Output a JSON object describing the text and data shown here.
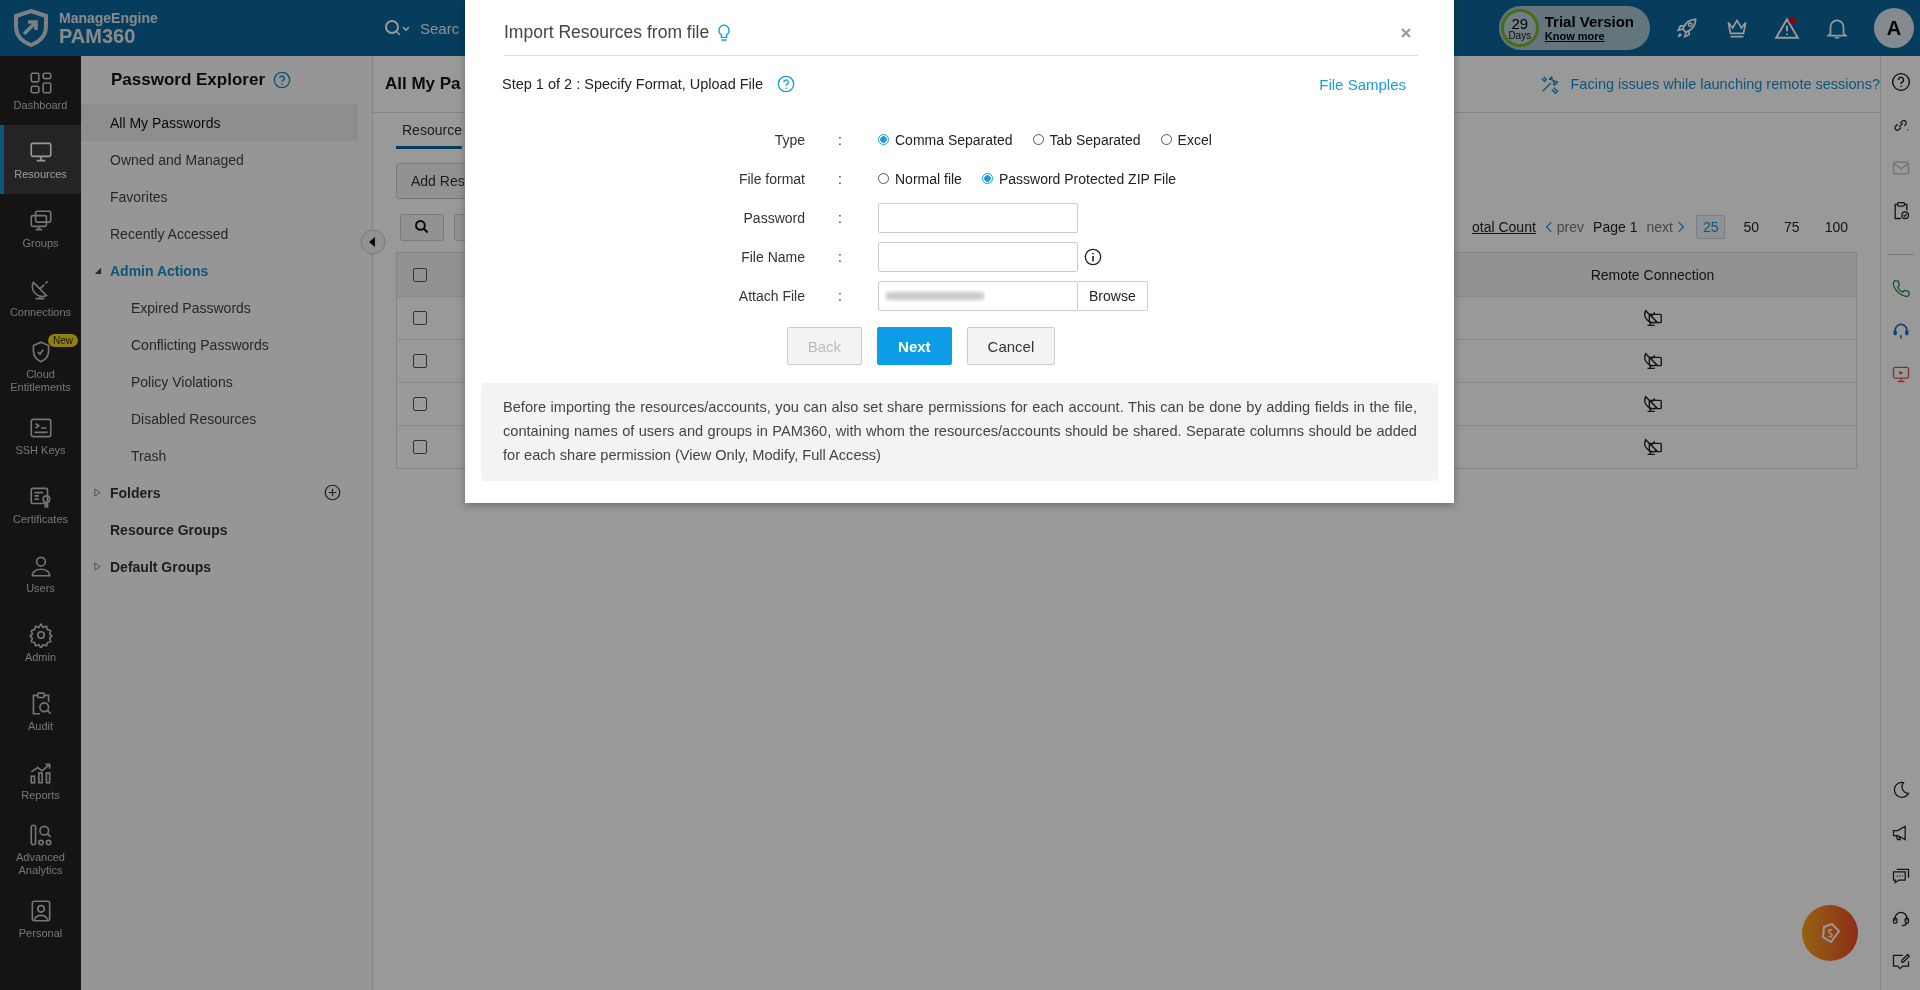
{
  "header": {
    "logo_top": "ManageEngine",
    "logo_bottom": "PAM360",
    "search_placeholder": "Searc",
    "trial": {
      "days": "29",
      "days_label": "Days",
      "title": "Trial Version",
      "link": "Know more"
    },
    "avatar": "A"
  },
  "rail": [
    {
      "label": "Dashboard",
      "selected": false
    },
    {
      "label": "Resources",
      "selected": true
    },
    {
      "label": "Groups",
      "selected": false
    },
    {
      "label": "Connections",
      "selected": false
    },
    {
      "label": "Cloud Entitlements",
      "selected": false,
      "badge": "New"
    },
    {
      "label": "SSH Keys",
      "selected": false
    },
    {
      "label": "Certificates",
      "selected": false
    },
    {
      "label": "Users",
      "selected": false
    },
    {
      "label": "Admin",
      "selected": false
    },
    {
      "label": "Audit",
      "selected": false
    },
    {
      "label": "Reports",
      "selected": false
    },
    {
      "label": "Advanced Analytics",
      "selected": false
    },
    {
      "label": "Personal",
      "selected": false
    }
  ],
  "explorer": {
    "title": "Password Explorer",
    "items": [
      {
        "kind": "item",
        "label": "All My Passwords",
        "selected": true
      },
      {
        "kind": "item",
        "label": "Owned and Managed",
        "selected": false
      },
      {
        "kind": "item",
        "label": "Favorites",
        "selected": false
      },
      {
        "kind": "item",
        "label": "Recently Accessed",
        "selected": false
      },
      {
        "kind": "group",
        "label": "Admin Actions",
        "expanded": true,
        "children": [
          {
            "label": "Expired Passwords",
            "selected": false
          },
          {
            "label": "Conflicting Passwords",
            "selected": false
          },
          {
            "label": "Policy Violations",
            "selected": false
          },
          {
            "label": "Disabled Resources",
            "selected": false
          },
          {
            "label": "Trash",
            "selected": false
          }
        ]
      },
      {
        "kind": "group",
        "label": "Folders",
        "expanded": false,
        "addable": true
      },
      {
        "kind": "group",
        "label": "Resource Groups"
      },
      {
        "kind": "group",
        "label": "Default Groups",
        "expanded": false
      }
    ]
  },
  "main": {
    "title": "All My Pa",
    "help_link": "Facing issues while launching remote sessions?",
    "tabs": [
      {
        "label": "Resource",
        "selected": true
      }
    ],
    "add_button": "Add Res",
    "pagination": {
      "total": "otal Count",
      "prev": "prev",
      "page": "Page 1",
      "next": "next",
      "sizes": [
        {
          "label": "25",
          "selected": true
        },
        {
          "label": "50",
          "selected": false
        },
        {
          "label": "75",
          "selected": false
        },
        {
          "label": "100",
          "selected": false
        }
      ]
    },
    "table": {
      "header_checked": false,
      "columns": [
        "Remote Connection"
      ],
      "rows": [
        {
          "checked": false
        },
        {
          "checked": false
        },
        {
          "checked": false
        },
        {
          "checked": false
        }
      ]
    }
  },
  "modal": {
    "title": "Import Resources from file",
    "step": "Step 1 of 2 : Specify Format, Upload File",
    "samples_link": "File Samples",
    "form": [
      {
        "kind": "radio",
        "label": "Type",
        "separator": ":",
        "options": [
          {
            "label": "Comma Separated",
            "selected": true
          },
          {
            "label": "Tab Separated",
            "selected": false
          },
          {
            "label": "Excel",
            "selected": false
          }
        ]
      },
      {
        "kind": "radio",
        "label": "File format",
        "separator": ":",
        "options": [
          {
            "label": "Normal file",
            "selected": false
          },
          {
            "label": "Password Protected ZIP File",
            "selected": true
          }
        ]
      },
      {
        "kind": "text",
        "label": "Password",
        "separator": ":"
      },
      {
        "kind": "text",
        "label": "File Name",
        "separator": ":",
        "info": true
      },
      {
        "kind": "file",
        "label": "Attach File",
        "separator": ":",
        "button": "Browse"
      }
    ],
    "buttons": [
      {
        "label": "Back",
        "kind": "secondary",
        "disabled": true
      },
      {
        "label": "Next",
        "kind": "primary",
        "disabled": false
      },
      {
        "label": "Cancel",
        "kind": "secondary",
        "disabled": false
      }
    ],
    "note": "Before importing the resources/accounts, you can also set share permissions for each account. This can be done by adding fields in the file, containing names of users and groups in PAM360, with whom the resources/accounts should be shared. Separate columns should be added for each share permission (View Only, Modify, Full Access)"
  }
}
